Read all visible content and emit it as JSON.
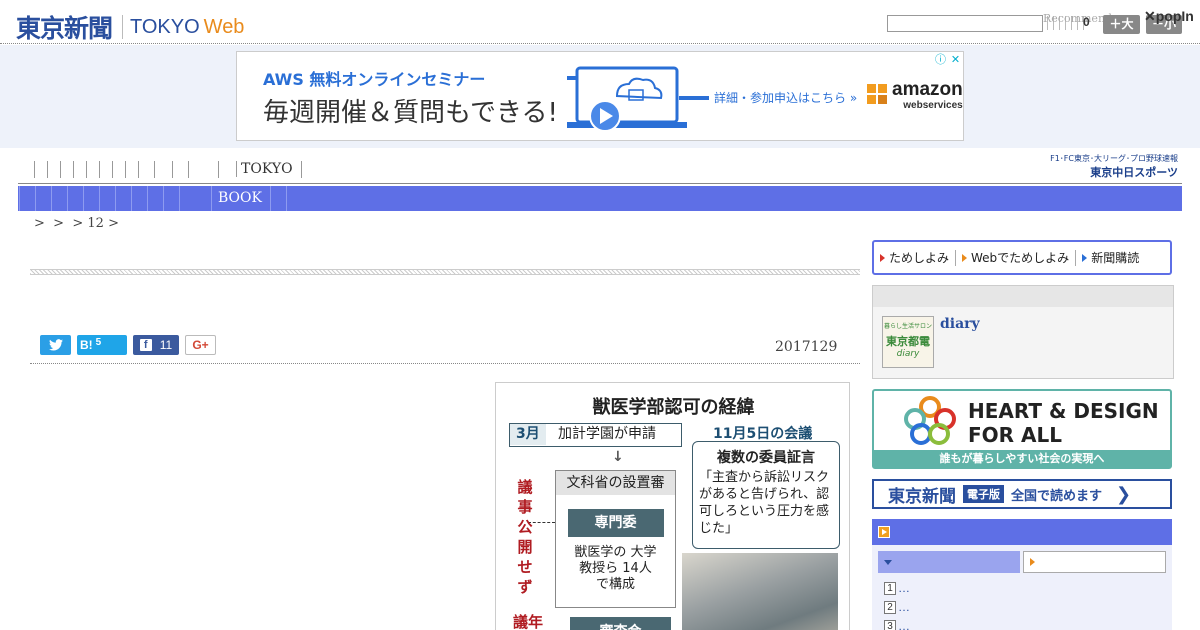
{
  "header": {
    "logo_jp": "東京新聞",
    "logo_tokyo": "TOKYO",
    "logo_web": "Web",
    "search_value": "",
    "recommend": "Recommend",
    "count": "0",
    "font_large": "＋大",
    "font_small": "－小",
    "popin": "✕popIn"
  },
  "ad": {
    "line1": "AWS 無料オンラインセミナー",
    "line2": "毎週開催＆質問もできる!",
    "link": "詳細・参加申込はこちら »",
    "brand": "amazon",
    "brand_sub": "webservices",
    "info_icon": "ⓘ",
    "close_icon": "✕"
  },
  "nav": {
    "primary_label": "TOKYO",
    "secondary_label": "BOOK",
    "chunichi_top": "F1･FC東京･大リーグ･プロ野球速報",
    "chunichi_bottom": "東京中日スポーツ"
  },
  "breadcrumb": {
    "sep1": ">",
    "sep2": ">",
    "sep3": ">",
    "item": "12",
    "sep4": ">"
  },
  "article": {
    "date": "2017129",
    "share": {
      "twitter_icon": "twitter-bird",
      "hatena_label": "B!",
      "hatena_count": "5",
      "facebook_count": "11",
      "gplus_label": "G+"
    }
  },
  "figure": {
    "title": "獣医学部認可の経緯",
    "step1_month": "3月",
    "step1_text": "加計学園が申請",
    "meeting": "11月5日の会議",
    "council": "文科省の設置審",
    "committee": "専門委",
    "committee_note": "獣医学の 大学教授ら 14人で構成",
    "testimony_title": "複数の委員証言",
    "testimony_body": "「主査から訴訟リスクがあると告げられ、認可しろという圧力を感じた」",
    "side_label": "議事公開せず",
    "side_label2": "議年",
    "review": "審査会",
    "arrow": "↓"
  },
  "sidebar": {
    "tab1": "ためしよみ",
    "tab2": "Webでためしよみ",
    "tab3": "新聞購読",
    "diary_thumb_top": "暮らし生活サロン",
    "diary_thumb_mid": "東京都電",
    "diary_thumb_bottom": "diary",
    "diary_link": "diary",
    "heart_line1": "HEART & DESIGN",
    "heart_line2": "FOR ALL",
    "heart_bar": "誰もが暮らしやすい社会の実現へ",
    "eban_logo": "東京新聞",
    "eban_badge": "電子版",
    "eban_text": "全国で読めます",
    "ranking": [
      {
        "num": "1",
        "text": "…"
      },
      {
        "num": "2",
        "text": "…"
      },
      {
        "num": "3",
        "text": "…"
      }
    ]
  },
  "colors": {
    "brand_blue": "#2a4f9e",
    "nav_blue": "#5e6fe6",
    "web_orange": "#e98b1c",
    "heart_teal": "#5fb3a8",
    "figure_red": "#b01c22"
  }
}
